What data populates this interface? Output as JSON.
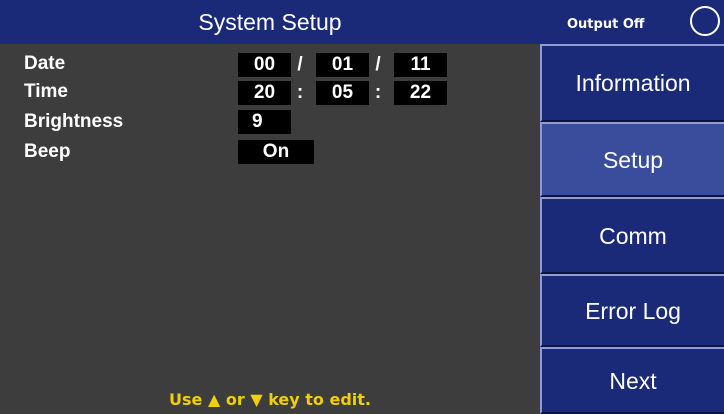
{
  "header": {
    "title": "System Setup",
    "output_status": "Output Off"
  },
  "settings": {
    "date": {
      "label": "Date",
      "year": "00",
      "month": "01",
      "day": "11",
      "separator": "/"
    },
    "time": {
      "label": "Time",
      "hour": "20",
      "minute": "05",
      "second": "22",
      "separator": ":"
    },
    "brightness": {
      "label": "Brightness",
      "value": "9"
    },
    "beep": {
      "label": "Beep",
      "value": "On"
    }
  },
  "hint": {
    "prefix": "Use",
    "up_arrow": "▲",
    "middle": "or",
    "down_arrow": "▼",
    "suffix": "key to edit."
  },
  "menu": {
    "items": [
      {
        "label": "Information"
      },
      {
        "label": "Setup",
        "active": true
      },
      {
        "label": "Comm"
      },
      {
        "label": "Error Log"
      },
      {
        "label": "Next"
      }
    ]
  },
  "colors": {
    "header_bg": "#1b2a78",
    "panel_bg": "#3d3d3d",
    "field_bg": "#000000",
    "hint_text": "#f2d000",
    "button_active_bg": "#3a4d9c"
  }
}
